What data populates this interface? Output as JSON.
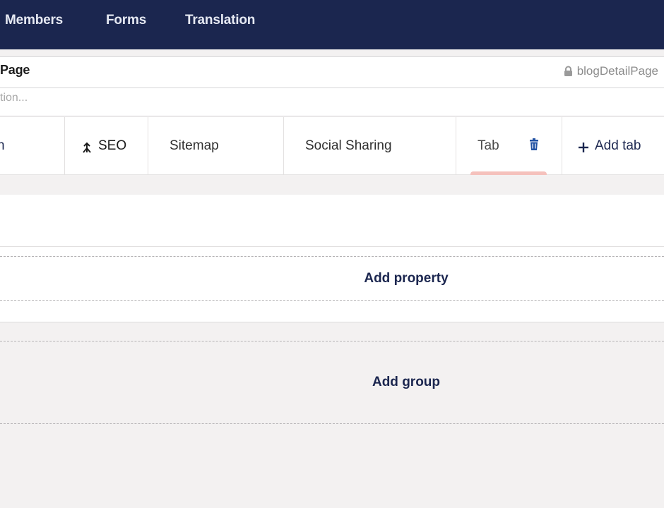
{
  "nav": {
    "items": [
      "Members",
      "Forms",
      "Translation"
    ]
  },
  "doc_type": {
    "name": "Page",
    "alias": "blogDetailPage",
    "description_placeholder": "tion..."
  },
  "tabs": {
    "items": [
      {
        "label": "n"
      },
      {
        "label": "SEO",
        "icon": "drag-handle-icon"
      },
      {
        "label": "Sitemap"
      },
      {
        "label": "Social Sharing"
      },
      {
        "label": "Tab",
        "active": true,
        "icon": "trash-icon"
      }
    ],
    "add_tab_label": "Add tab"
  },
  "group": {
    "add_property_label": "Add property"
  },
  "add_group_label": "Add group",
  "colors": {
    "topbar": "#1b264f",
    "accent": "#1b264f",
    "active_tab_indicator": "#f5c1bc",
    "trash": "#2152a3"
  }
}
